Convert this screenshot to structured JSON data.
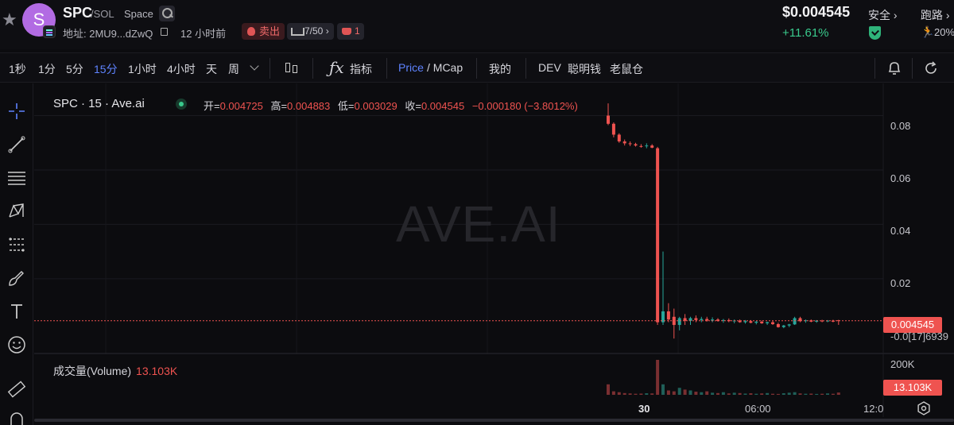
{
  "header": {
    "symbol": "SPC",
    "chain": "/SOL",
    "name": "Space",
    "avatar_letter": "S",
    "address_label": "地址: 2MU9...dZwQ",
    "time_ago": "12 小时前",
    "sell_label": "卖出",
    "holders_label": "7/50",
    "rug_count": "1",
    "price": "$0.004545",
    "change": "+11.61%",
    "safety_label": "安全",
    "run_label": "跑路",
    "run_pct": "20%"
  },
  "toolbar": {
    "intervals": [
      "1秒",
      "1分",
      "5分",
      "15分",
      "1小时",
      "4小时",
      "天",
      "周"
    ],
    "active_interval": "15分",
    "indicators_label": "指标",
    "price_label": "Price",
    "mcap_label": "/ MCap",
    "mine_label": "我的",
    "dev_label": "DEV",
    "smart_money_label": "聪明钱",
    "rat_label": "老鼠仓"
  },
  "chart": {
    "legend_title": "SPC · 15 · Ave.ai",
    "ohlc": {
      "open_key": "开=",
      "open": "0.004725",
      "high_key": "高=",
      "high": "0.004883",
      "low_key": "低=",
      "low": "0.003029",
      "close_key": "收=",
      "close": "0.004545",
      "change": "−0.000180 (−3.8012%)"
    },
    "watermark": "AVE.AI",
    "current_price_tag": "0.004545",
    "current_price_sub": "-0.0[17]6939",
    "volume_legend": "成交量(Volume)",
    "volume_value": "13.103K",
    "volume_tag": "13.103K",
    "volume_axis_label": "200K"
  },
  "chart_data": {
    "type": "candlestick",
    "y_ticks": [
      "0.08",
      "0.06",
      "0.04",
      "0.02"
    ],
    "x_ticks": [
      "30",
      "06:00",
      "12:0"
    ],
    "ylim": [
      -0.004,
      0.086
    ],
    "grid": true,
    "candles": [
      {
        "o": 0.08,
        "h": 0.0845,
        "l": 0.0765,
        "c": 0.077
      },
      {
        "o": 0.077,
        "h": 0.0775,
        "l": 0.072,
        "c": 0.073
      },
      {
        "o": 0.073,
        "h": 0.0735,
        "l": 0.07,
        "c": 0.0705
      },
      {
        "o": 0.0705,
        "h": 0.0712,
        "l": 0.069,
        "c": 0.0698
      },
      {
        "o": 0.0698,
        "h": 0.0705,
        "l": 0.0688,
        "c": 0.0695
      },
      {
        "o": 0.0695,
        "h": 0.07,
        "l": 0.0686,
        "c": 0.069
      },
      {
        "o": 0.0688,
        "h": 0.0695,
        "l": 0.0682,
        "c": 0.0686
      },
      {
        "o": 0.0688,
        "h": 0.0698,
        "l": 0.068,
        "c": 0.069
      },
      {
        "o": 0.069,
        "h": 0.0695,
        "l": 0.068,
        "c": 0.0682
      },
      {
        "o": 0.068,
        "h": 0.0685,
        "l": 0.003,
        "c": 0.004
      },
      {
        "o": 0.004,
        "h": 0.03,
        "l": 0.003,
        "c": 0.008
      },
      {
        "o": 0.008,
        "h": 0.011,
        "l": 0.004,
        "c": 0.005
      },
      {
        "o": 0.006,
        "h": 0.009,
        "l": -0.002,
        "c": 0.003
      },
      {
        "o": 0.003,
        "h": 0.006,
        "l": 0.001,
        "c": 0.0055
      },
      {
        "o": 0.0055,
        "h": 0.007,
        "l": 0.003,
        "c": 0.0045
      },
      {
        "o": 0.0045,
        "h": 0.006,
        "l": 0.003,
        "c": 0.0055
      },
      {
        "o": 0.0055,
        "h": 0.0065,
        "l": 0.004,
        "c": 0.0048
      },
      {
        "o": 0.0048,
        "h": 0.006,
        "l": 0.004,
        "c": 0.0052
      },
      {
        "o": 0.0052,
        "h": 0.006,
        "l": 0.0042,
        "c": 0.0046
      },
      {
        "o": 0.0046,
        "h": 0.0058,
        "l": 0.004,
        "c": 0.005
      },
      {
        "o": 0.005,
        "h": 0.0055,
        "l": 0.0042,
        "c": 0.0045
      },
      {
        "o": 0.0045,
        "h": 0.0052,
        "l": 0.0038,
        "c": 0.0048
      },
      {
        "o": 0.0048,
        "h": 0.0054,
        "l": 0.004,
        "c": 0.0044
      },
      {
        "o": 0.0044,
        "h": 0.005,
        "l": 0.0036,
        "c": 0.0046
      },
      {
        "o": 0.0046,
        "h": 0.005,
        "l": 0.0038,
        "c": 0.004
      },
      {
        "o": 0.004,
        "h": 0.0048,
        "l": 0.0035,
        "c": 0.0044
      },
      {
        "o": 0.0044,
        "h": 0.0048,
        "l": 0.0036,
        "c": 0.0038
      },
      {
        "o": 0.0038,
        "h": 0.0045,
        "l": 0.0032,
        "c": 0.0042
      },
      {
        "o": 0.0042,
        "h": 0.0046,
        "l": 0.0034,
        "c": 0.0036
      },
      {
        "o": 0.0036,
        "h": 0.0042,
        "l": 0.003,
        "c": 0.004
      },
      {
        "o": 0.004,
        "h": 0.0044,
        "l": 0.003,
        "c": 0.0033
      },
      {
        "o": 0.0033,
        "h": 0.0038,
        "l": 0.002,
        "c": 0.0022
      },
      {
        "o": 0.0022,
        "h": 0.003,
        "l": 0.0018,
        "c": 0.0028
      },
      {
        "o": 0.0028,
        "h": 0.0034,
        "l": 0.0022,
        "c": 0.0032
      },
      {
        "o": 0.0032,
        "h": 0.006,
        "l": 0.003,
        "c": 0.0055
      },
      {
        "o": 0.0055,
        "h": 0.006,
        "l": 0.004,
        "c": 0.0044
      },
      {
        "o": 0.0044,
        "h": 0.005,
        "l": 0.0038,
        "c": 0.0047
      },
      {
        "o": 0.0047,
        "h": 0.005,
        "l": 0.004,
        "c": 0.0042
      },
      {
        "o": 0.0042,
        "h": 0.0048,
        "l": 0.0038,
        "c": 0.0046
      },
      {
        "o": 0.0046,
        "h": 0.0049,
        "l": 0.004,
        "c": 0.0043
      },
      {
        "o": 0.0043,
        "h": 0.0048,
        "l": 0.004,
        "c": 0.0046
      },
      {
        "o": 0.0046,
        "h": 0.0049,
        "l": 0.004,
        "c": 0.0042
      },
      {
        "o": 0.004725,
        "h": 0.004883,
        "l": 0.003029,
        "c": 0.004545
      }
    ],
    "volume_max": 200000,
    "volumes": [
      60000,
      20000,
      15000,
      10000,
      8000,
      6000,
      7000,
      9000,
      8000,
      200000,
      60000,
      25000,
      20000,
      40000,
      30000,
      25000,
      18000,
      15000,
      20000,
      12000,
      10000,
      15000,
      8000,
      12000,
      10000,
      7000,
      9000,
      6000,
      8000,
      10000,
      6000,
      5000,
      9000,
      12000,
      15000,
      8000,
      6000,
      7000,
      5000,
      6000,
      8000,
      6000,
      13103
    ]
  }
}
